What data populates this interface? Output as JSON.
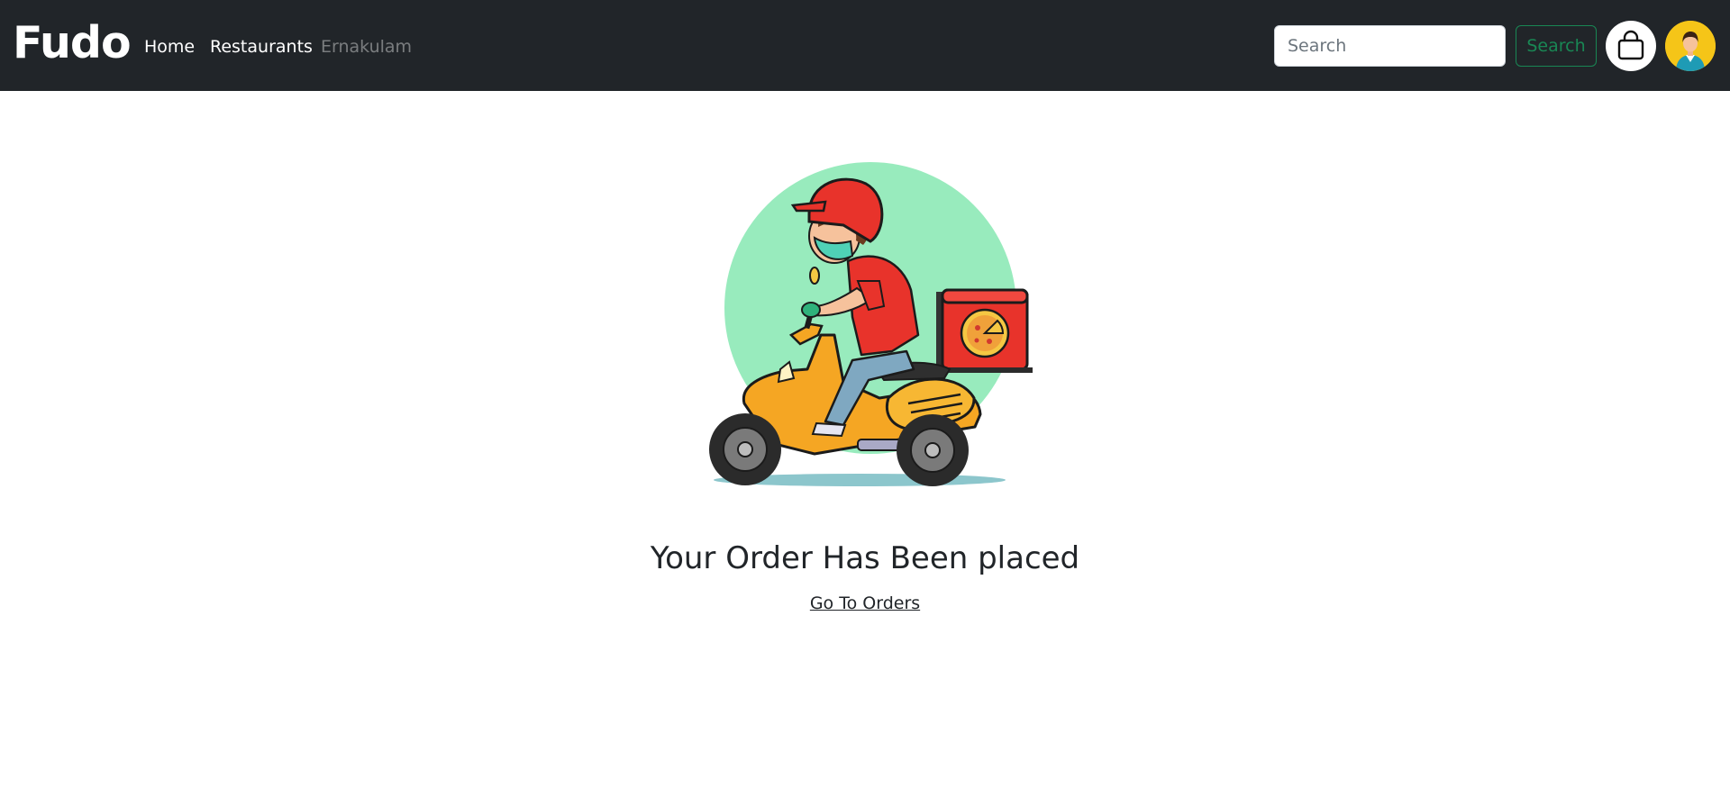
{
  "navbar": {
    "brand": "Fudo",
    "links": [
      {
        "label": "Home"
      },
      {
        "label": "Restaurants"
      },
      {
        "label": "Ernakulam"
      }
    ],
    "search": {
      "placeholder": "Search",
      "value": "",
      "button_label": "Search"
    },
    "cart_icon": "shopping-bag-icon",
    "avatar_icon": "user-avatar-icon"
  },
  "main": {
    "illustration_subject": "delivery-scooter-icon",
    "title": "Your Order Has Been placed",
    "orders_link": "Go To Orders"
  },
  "colors": {
    "navbar_bg": "#212529",
    "accent_green": "#198754",
    "avatar_bg": "#f5c518",
    "illustration_circle": "#98ebbd"
  }
}
